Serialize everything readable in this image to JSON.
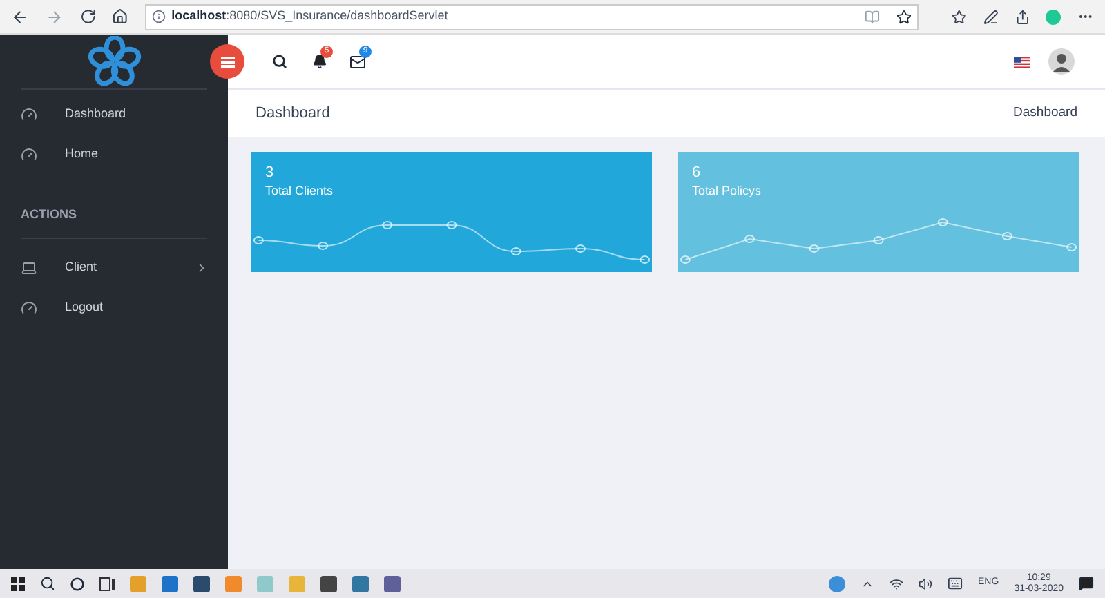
{
  "browser": {
    "url_host": "localhost",
    "url_rest": ":8080/SVS_Insurance/dashboardServlet"
  },
  "header": {
    "notifications": "5",
    "messages": "9"
  },
  "sidebar": {
    "items": [
      {
        "label": "Dashboard",
        "kind": "link"
      },
      {
        "label": "Home",
        "kind": "link"
      },
      {
        "label": "ACTIONS",
        "kind": "heading"
      },
      {
        "label": "Client",
        "kind": "submenu"
      },
      {
        "label": "Logout",
        "kind": "link"
      }
    ]
  },
  "page": {
    "title": "Dashboard",
    "breadcrumb": "Dashboard"
  },
  "cards": [
    {
      "value": "3",
      "label": "Total Clients",
      "color": "#21a7d9",
      "kind": "curve"
    },
    {
      "value": "6",
      "label": "Total Policys",
      "color": "#63c0de",
      "kind": "straight"
    }
  ],
  "taskbar": {
    "language": "ENG",
    "time": "10:29",
    "date": "31-03-2020"
  }
}
